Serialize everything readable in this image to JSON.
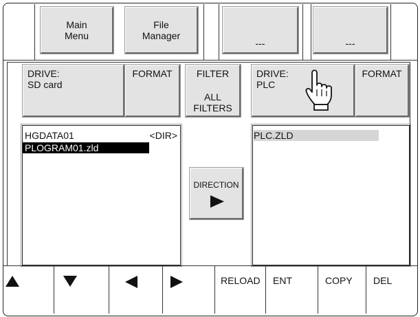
{
  "top_buttons": {
    "main_menu": "Main\nMenu",
    "file_manager": "File\nManager",
    "slot3": "---",
    "slot4": "---"
  },
  "left_drive": {
    "label": "DRIVE:\nSD  card",
    "format": "FORMAT"
  },
  "right_drive": {
    "label": "DRIVE:\nPLC",
    "format": "FORMAT"
  },
  "filter": {
    "title": "FILTER",
    "value": "ALL\nFILTERS"
  },
  "left_files": [
    {
      "name": "HGDATA01",
      "type": "<DIR>"
    },
    {
      "name": "PLOGRAM01.zld",
      "type": ""
    }
  ],
  "right_files": [
    {
      "name": "PLC.ZLD"
    }
  ],
  "direction": {
    "label": "DIRECTION",
    "arrow_icon": "right-triangle-icon"
  },
  "bottom": {
    "up_icon": "up-triangle-icon",
    "down_icon": "down-triangle-icon",
    "left_icon": "left-triangle-icon",
    "right_icon": "right-triangle-icon",
    "reload": "RELOAD",
    "ent": "ENT",
    "copy": "COPY",
    "del": "DEL"
  },
  "pointer_icon": "hand-pointer-icon"
}
